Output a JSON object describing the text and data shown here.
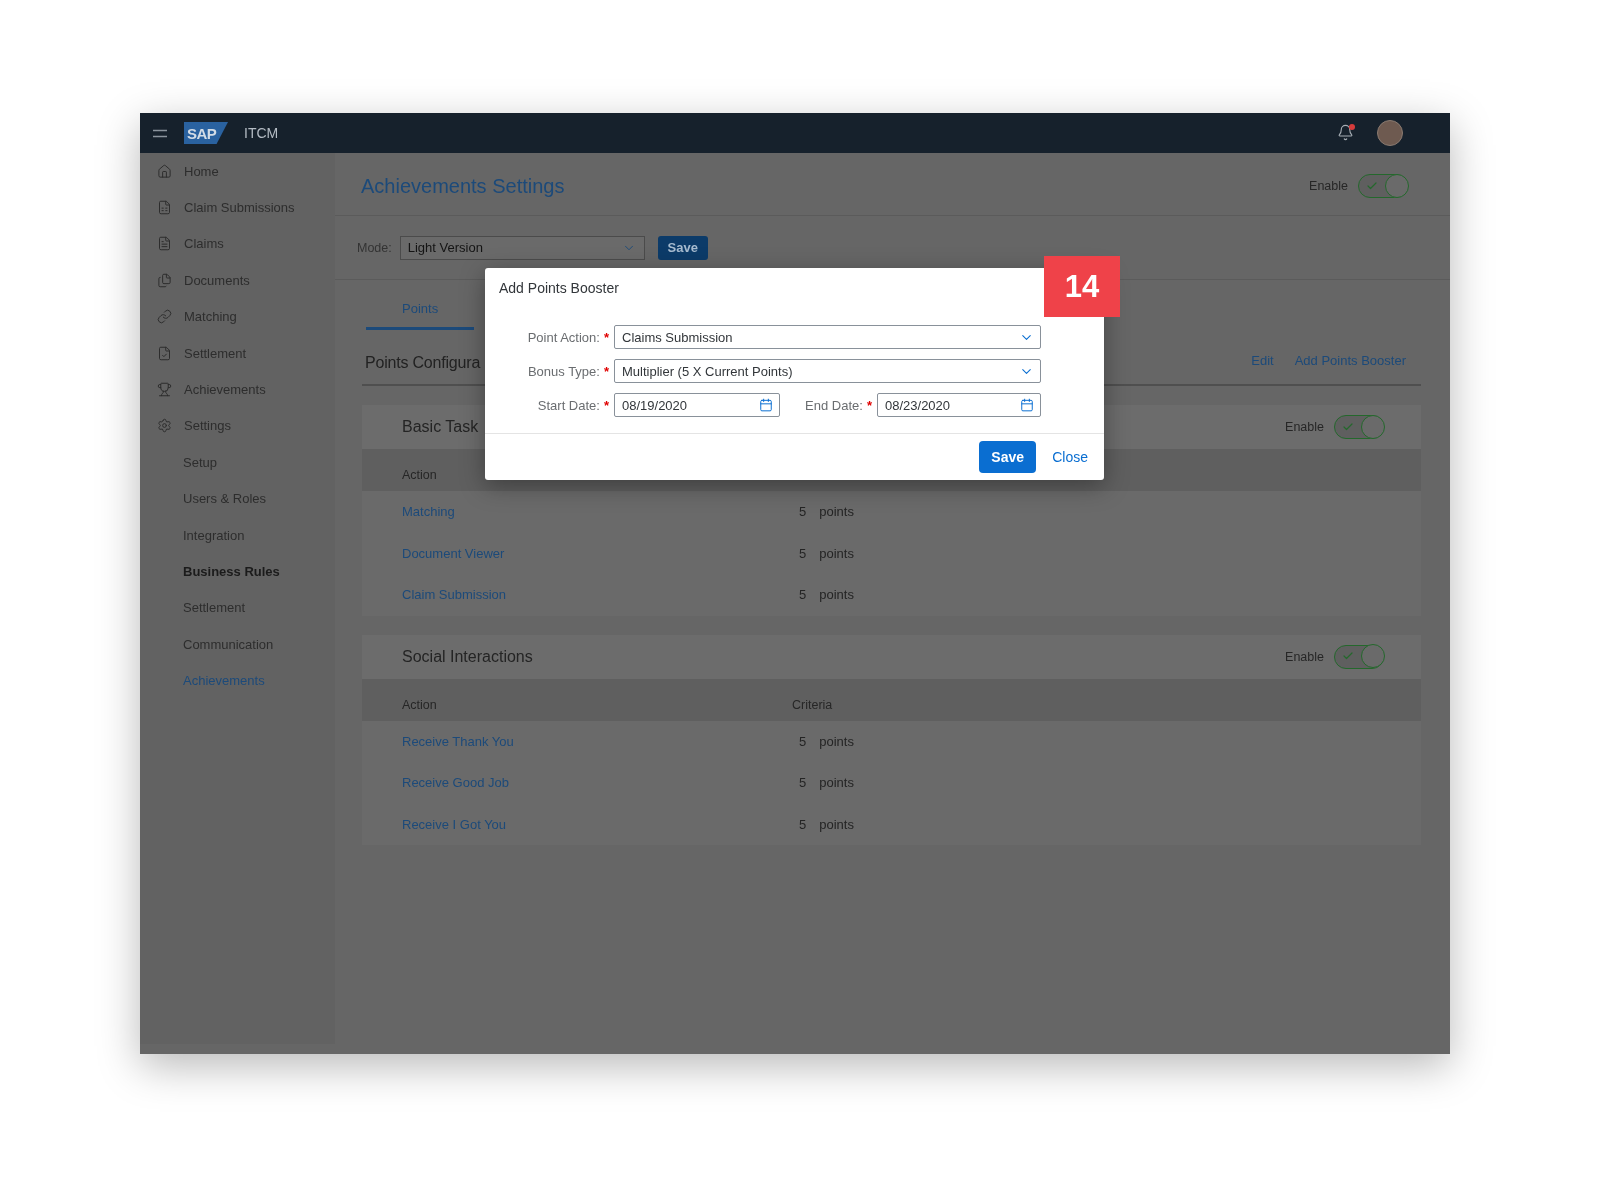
{
  "top_bar": {
    "logo": "SAP",
    "app_name": "ITCM",
    "notifications": {
      "unread": true
    }
  },
  "sidebar": {
    "items": [
      {
        "label": "Home",
        "selected": false
      },
      {
        "label": "Claim Submissions",
        "selected": false
      },
      {
        "label": "Claims",
        "selected": false
      },
      {
        "label": "Documents",
        "selected": false
      },
      {
        "label": "Matching",
        "selected": false
      },
      {
        "label": "Settlement",
        "selected": false
      },
      {
        "label": "Achievements",
        "selected": false
      },
      {
        "label": "Settings",
        "selected": false,
        "children": [
          {
            "label": "Setup",
            "kind": "item",
            "selected": false
          },
          {
            "label": "Users & Roles",
            "kind": "item",
            "selected": false
          },
          {
            "label": "Integration",
            "kind": "item",
            "selected": false
          },
          {
            "label": "Business Rules",
            "kind": "heading",
            "selected": false
          },
          {
            "label": "Settlement",
            "kind": "item",
            "selected": false
          },
          {
            "label": "Communication",
            "kind": "item",
            "selected": false
          },
          {
            "label": "Achievements",
            "kind": "item",
            "selected": true
          }
        ]
      }
    ]
  },
  "header": {
    "title": "Achievements Settings",
    "enable": {
      "label": "Enable",
      "on": true
    }
  },
  "mode": {
    "label": "Mode:",
    "value": "Light Version",
    "button": "Save"
  },
  "tabs": [
    {
      "label": "Points",
      "selected": true
    }
  ],
  "section": {
    "title": "Points Configura",
    "actions": [
      "Edit",
      "Add Points Booster"
    ]
  },
  "groups": [
    {
      "title": "Basic Task",
      "enable": {
        "label": "Enable",
        "on": true
      },
      "columns": [
        "Action"
      ],
      "rows": [
        {
          "action": "Matching",
          "criteria_value": "5",
          "criteria_unit": "points"
        },
        {
          "action": "Document Viewer",
          "criteria_value": "5",
          "criteria_unit": "points"
        },
        {
          "action": "Claim Submission",
          "criteria_value": "5",
          "criteria_unit": "points"
        }
      ]
    },
    {
      "title": "Social Interactions",
      "enable": {
        "label": "Enable",
        "on": true
      },
      "columns": [
        "Action",
        "Criteria"
      ],
      "rows": [
        {
          "action": "Receive Thank You",
          "criteria_value": "5",
          "criteria_unit": "points"
        },
        {
          "action": "Receive Good Job",
          "criteria_value": "5",
          "criteria_unit": "points"
        },
        {
          "action": "Receive I Got You",
          "criteria_value": "5",
          "criteria_unit": "points"
        }
      ]
    }
  ],
  "dialog": {
    "title": "Add Points Booster",
    "fields": [
      {
        "kind": "select",
        "label": "Point Action:",
        "required_mark": "*",
        "value": "Claims Submission"
      },
      {
        "kind": "select",
        "label": "Bonus Type:",
        "required_mark": "*",
        "value": "Multiplier (5 X Current Points)"
      },
      {
        "kind": "date",
        "label": "Start Date:",
        "required_mark": "*",
        "value": "08/19/2020"
      },
      {
        "kind": "date",
        "label": "End Date:",
        "required_mark": "*",
        "value": "08/23/2020"
      }
    ],
    "buttons": [
      {
        "kind": "primary",
        "label": "Save"
      },
      {
        "kind": "link",
        "label": "Close"
      }
    ]
  },
  "step_badge": {
    "number": "14"
  }
}
